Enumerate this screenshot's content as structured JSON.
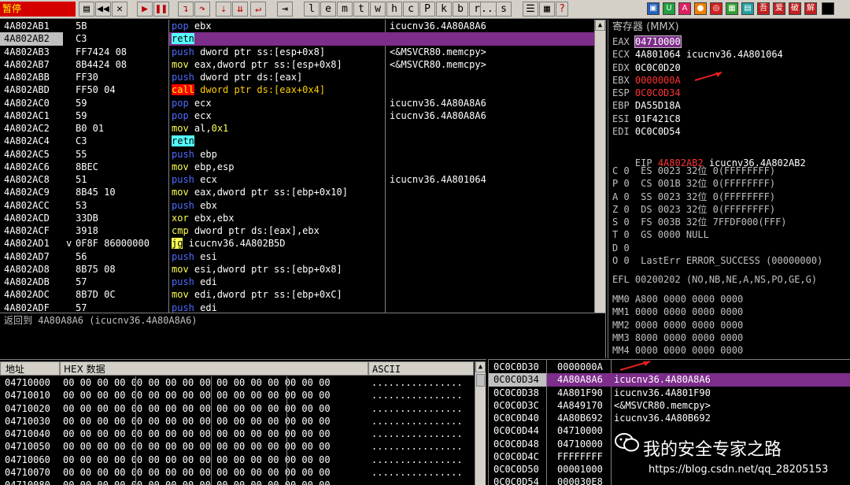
{
  "toolbar": {
    "status_label": "暂停",
    "buttons": [
      "l",
      "e",
      "m",
      "t",
      "w",
      "h",
      "c",
      "P",
      "k",
      "b",
      "r",
      "...",
      "s",
      "?"
    ]
  },
  "disasm": {
    "rows": [
      {
        "addr": "4A802AB1",
        "hex": "5B",
        "mn": "pop",
        "ops": " ebx",
        "cmt": "icucnv36.4A80A8A6",
        "style": "pushpop"
      },
      {
        "addr": "4A802AB2",
        "hex": "C3",
        "mn": "retn",
        "ops": "",
        "cmt": "",
        "style": "ret",
        "selected": true
      },
      {
        "addr": "4A802AB3",
        "hex": "FF7424 08",
        "mn": "push",
        "ops": " dword ptr ss:[esp+0x8]",
        "cmt": "<&MSVCR80.memcpy>",
        "style": "pushpop"
      },
      {
        "addr": "4A802AB7",
        "hex": "8B4424 08",
        "mn": "mov",
        "ops": " eax,dword ptr ss:[esp+0x8]",
        "cmt": "<&MSVCR80.memcpy>",
        "style": "mov"
      },
      {
        "addr": "4A802ABB",
        "hex": "FF30",
        "mn": "push",
        "ops": " dword ptr ds:[eax]",
        "cmt": "",
        "style": "pushpop"
      },
      {
        "addr": "4A802ABD",
        "hex": "FF50 04",
        "mn": "call",
        "ops": " dword ptr ds:[eax+0x4]",
        "cmt": "",
        "style": "call"
      },
      {
        "addr": "4A802AC0",
        "hex": "59",
        "mn": "pop",
        "ops": " ecx",
        "cmt": "icucnv36.4A80A8A6",
        "style": "pushpop"
      },
      {
        "addr": "4A802AC1",
        "hex": "59",
        "mn": "pop",
        "ops": " ecx",
        "cmt": "icucnv36.4A80A8A6",
        "style": "pushpop"
      },
      {
        "addr": "4A802AC2",
        "hex": "B0 01",
        "mn": "mov",
        "ops": " al,",
        "imm": "0x1",
        "cmt": "",
        "style": "mov"
      },
      {
        "addr": "4A802AC4",
        "hex": "C3",
        "mn": "retn",
        "ops": "",
        "cmt": "",
        "style": "ret"
      },
      {
        "addr": "4A802AC5",
        "hex": "55",
        "mn": "push",
        "ops": " ebp",
        "cmt": "",
        "style": "pushpop"
      },
      {
        "addr": "4A802AC6",
        "hex": "8BEC",
        "mn": "mov",
        "ops": " ebp,esp",
        "cmt": "",
        "style": "mov"
      },
      {
        "addr": "4A802AC8",
        "hex": "51",
        "mn": "push",
        "ops": " ecx",
        "cmt": "icucnv36.4A801064",
        "style": "pushpop"
      },
      {
        "addr": "4A802AC9",
        "hex": "8B45 10",
        "mn": "mov",
        "ops": " eax,dword ptr ss:[ebp+0x10]",
        "cmt": "",
        "style": "mov"
      },
      {
        "addr": "4A802ACC",
        "hex": "53",
        "mn": "push",
        "ops": " ebx",
        "cmt": "",
        "style": "pushpop"
      },
      {
        "addr": "4A802ACD",
        "hex": "33DB",
        "mn": "xor",
        "ops": " ebx,ebx",
        "cmt": "",
        "style": "mov"
      },
      {
        "addr": "4A802ACF",
        "hex": "3918",
        "mn": "cmp",
        "ops": " dword ptr ds:[eax],ebx",
        "cmt": "",
        "style": "cmp"
      },
      {
        "addr": "4A802AD1",
        "hex": "0F8F 86000000",
        "mn": "jg",
        "ops": " icucnv36.4A802B5D",
        "cmt": "",
        "style": "jmp",
        "mark": "v"
      },
      {
        "addr": "4A802AD7",
        "hex": "56",
        "mn": "push",
        "ops": " esi",
        "cmt": "",
        "style": "pushpop"
      },
      {
        "addr": "4A802AD8",
        "hex": "8B75 08",
        "mn": "mov",
        "ops": " esi,dword ptr ss:[ebp+0x8]",
        "cmt": "",
        "style": "mov"
      },
      {
        "addr": "4A802ADB",
        "hex": "57",
        "mn": "push",
        "ops": " edi",
        "cmt": "",
        "style": "pushpop"
      },
      {
        "addr": "4A802ADC",
        "hex": "8B7D 0C",
        "mn": "mov",
        "ops": " edi,dword ptr ss:[ebp+0xC]",
        "cmt": "",
        "style": "mov"
      },
      {
        "addr": "4A802ADF",
        "hex": "57",
        "mn": "push",
        "ops": " edi",
        "cmt": "",
        "style": "pushpop"
      }
    ],
    "info_line": "返回到 4A80A8A6 (icucnv36.4A80A8A6)"
  },
  "registers": {
    "title": "寄存器 (MMX)",
    "gp": [
      {
        "name": "EAX",
        "value": "04710000",
        "extra": "",
        "changed": false,
        "boxed": true
      },
      {
        "name": "ECX",
        "value": "4A801064",
        "extra": " icucnv36.4A801064",
        "changed": false
      },
      {
        "name": "EDX",
        "value": "0C0C0D20",
        "extra": "",
        "changed": false
      },
      {
        "name": "EBX",
        "value": "0000000A",
        "extra": "",
        "changed": true
      },
      {
        "name": "ESP",
        "value": "0C0C0D34",
        "extra": "",
        "changed": true
      },
      {
        "name": "EBP",
        "value": "DA55D18A",
        "extra": "",
        "changed": false
      },
      {
        "name": "ESI",
        "value": "01F421C8",
        "extra": "",
        "changed": false
      },
      {
        "name": "EDI",
        "value": "0C0C0D54",
        "extra": "",
        "changed": false
      }
    ],
    "eip": {
      "name": "EIP",
      "value": "4A802AB2",
      "extra": " icucnv36.4A802AB2"
    },
    "flags": [
      "C 0  ES 0023 32位 0(FFFFFFFF)",
      "P 0  CS 001B 32位 0(FFFFFFFF)",
      "A 0  SS 0023 32位 0(FFFFFFFF)",
      "Z 0  DS 0023 32位 0(FFFFFFFF)",
      "S 0  FS 003B 32位 7FFDF000(FFF)",
      "T 0  GS 0000 NULL",
      "D 0",
      "O 0  LastErr ERROR_SUCCESS (00000000)"
    ],
    "efl": "EFL 00200202 (NO,NB,NE,A,NS,PO,GE,G)",
    "mmx": [
      "MM0 A800 0000 0000 0000",
      "MM1 0000 0000 0000 0000",
      "MM2 0000 0000 0000 0000",
      "MM3 8000 0000 0000 0000",
      "MM4 0000 0000 0000 0000"
    ]
  },
  "dump": {
    "col_addr": "地址",
    "col_hex": "HEX 数据",
    "col_ascii": "ASCII",
    "rows": [
      {
        "addr": "04710000",
        "hex": "00 00 00 00 00 00 00 00 00 00 00 00 00 00 00 00",
        "ascii": "................"
      },
      {
        "addr": "04710010",
        "hex": "00 00 00 00 00 00 00 00 00 00 00 00 00 00 00 00",
        "ascii": "................"
      },
      {
        "addr": "04710020",
        "hex": "00 00 00 00 00 00 00 00 00 00 00 00 00 00 00 00",
        "ascii": "................"
      },
      {
        "addr": "04710030",
        "hex": "00 00 00 00 00 00 00 00 00 00 00 00 00 00 00 00",
        "ascii": "................"
      },
      {
        "addr": "04710040",
        "hex": "00 00 00 00 00 00 00 00 00 00 00 00 00 00 00 00",
        "ascii": "................"
      },
      {
        "addr": "04710050",
        "hex": "00 00 00 00 00 00 00 00 00 00 00 00 00 00 00 00",
        "ascii": "................"
      },
      {
        "addr": "04710060",
        "hex": "00 00 00 00 00 00 00 00 00 00 00 00 00 00 00 00",
        "ascii": "................"
      },
      {
        "addr": "04710070",
        "hex": "00 00 00 00 00 00 00 00 00 00 00 00 00 00 00 00",
        "ascii": "................"
      },
      {
        "addr": "04710080",
        "hex": "00 00 00 00 00 00 00 00 00 00 00 00 00 00 00 00",
        "ascii": "................"
      }
    ]
  },
  "stack": {
    "rows": [
      {
        "addr": "0C0C0D30",
        "val": "0000000A",
        "cmt": ""
      },
      {
        "addr": "0C0C0D34",
        "val": "4A80A8A6",
        "cmt": "icucnv36.4A80A8A6",
        "selected": true
      },
      {
        "addr": "0C0C0D38",
        "val": "4A801F90",
        "cmt": "icucnv36.4A801F90"
      },
      {
        "addr": "0C0C0D3C",
        "val": "4A849170",
        "cmt": "<&MSVCR80.memcpy>"
      },
      {
        "addr": "0C0C0D40",
        "val": "4A80B692",
        "cmt": "icucnv36.4A80B692"
      },
      {
        "addr": "0C0C0D44",
        "val": "04710000",
        "cmt": ""
      },
      {
        "addr": "0C0C0D48",
        "val": "04710000",
        "cmt": ""
      },
      {
        "addr": "0C0C0D4C",
        "val": "FFFFFFFF",
        "cmt": ""
      },
      {
        "addr": "0C0C0D50",
        "val": "00001000",
        "cmt": ""
      },
      {
        "addr": "0C0C0D54",
        "val": "000030E8",
        "cmt": ""
      }
    ]
  },
  "watermark": {
    "title": "我的安全专家之路",
    "url": "https://blog.csdn.net/qq_28205153"
  },
  "colors": {
    "selection": "#7d2d8a",
    "changed_register": "#ff3333",
    "mnemonic_push": "#4f6bff",
    "arrow": "#e02020"
  }
}
